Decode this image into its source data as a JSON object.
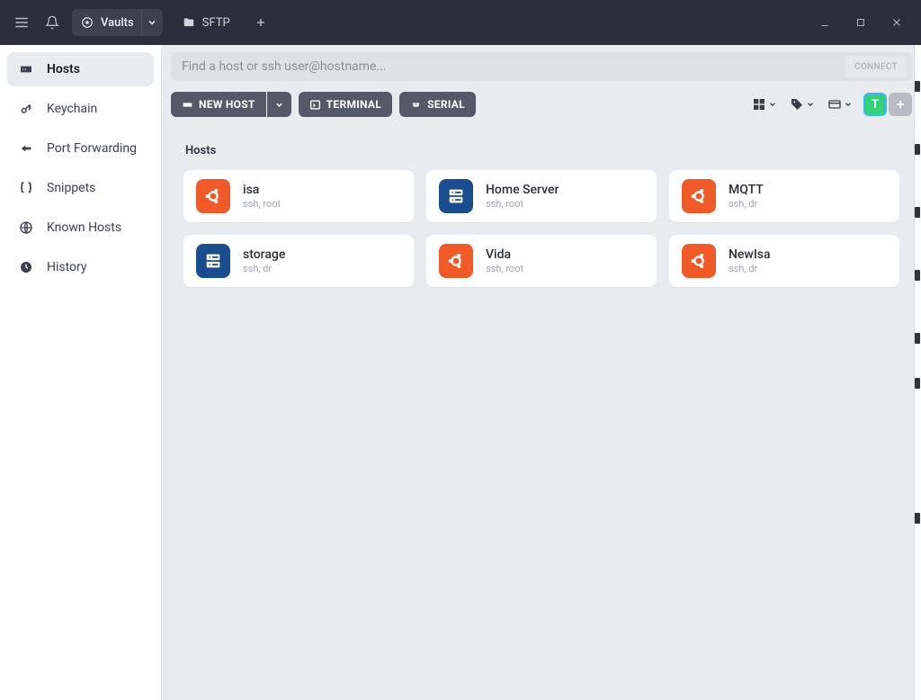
{
  "titlebar": {
    "vaults_label": "Vaults",
    "sftp_label": "SFTP"
  },
  "sidebar": [
    {
      "id": "hosts",
      "label": "Hosts",
      "active": true
    },
    {
      "id": "keychain",
      "label": "Keychain"
    },
    {
      "id": "port-fwd",
      "label": "Port Forwarding"
    },
    {
      "id": "snippets",
      "label": "Snippets"
    },
    {
      "id": "known-hosts",
      "label": "Known Hosts"
    },
    {
      "id": "history",
      "label": "History"
    }
  ],
  "search": {
    "placeholder": "Find a host or ssh user@hostname...",
    "connect_label": "CONNECT"
  },
  "toolbar": {
    "new_host": "NEW HOST",
    "terminal": "TERMINAL",
    "serial": "SERIAL"
  },
  "avatar": {
    "letter": "T"
  },
  "section_title": "Hosts",
  "hosts": [
    {
      "name": "isa",
      "sub": "ssh, root",
      "icon": "ubuntu"
    },
    {
      "name": "Home Server",
      "sub": "ssh, root",
      "icon": "server"
    },
    {
      "name": "MQTT",
      "sub": "ssh, dr",
      "icon": "ubuntu"
    },
    {
      "name": "storage",
      "sub": "ssh, dr",
      "icon": "server"
    },
    {
      "name": "Vida",
      "sub": "ssh, root",
      "icon": "ubuntu"
    },
    {
      "name": "NewIsa",
      "sub": "ssh, dr",
      "icon": "ubuntu"
    }
  ]
}
